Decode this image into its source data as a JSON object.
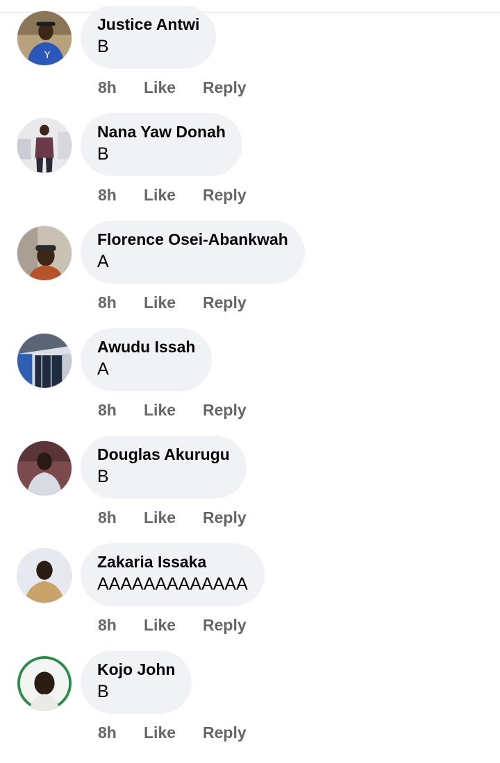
{
  "comments": [
    {
      "author": "Justice Antwi",
      "text": "B",
      "time": "8h",
      "like": "Like",
      "reply": "Reply"
    },
    {
      "author": "Nana Yaw Donah",
      "text": "B",
      "time": "8h",
      "like": "Like",
      "reply": "Reply"
    },
    {
      "author": "Florence Osei-Abankwah",
      "text": "A",
      "time": "8h",
      "like": "Like",
      "reply": "Reply"
    },
    {
      "author": "Awudu Issah",
      "text": "A",
      "time": "8h",
      "like": "Like",
      "reply": "Reply"
    },
    {
      "author": "Douglas Akurugu",
      "text": "B",
      "time": "8h",
      "like": "Like",
      "reply": "Reply"
    },
    {
      "author": "Zakaria Issaka",
      "text": "AAAAAAAAAAAAA",
      "time": "8h",
      "like": "Like",
      "reply": "Reply"
    },
    {
      "author": "Kojo John",
      "text": "B",
      "time": "8h",
      "like": "Like",
      "reply": "Reply"
    }
  ],
  "colors": {
    "bubble_bg": "#f0f2f5",
    "action_text": "#65676b",
    "author_text": "#050505"
  }
}
